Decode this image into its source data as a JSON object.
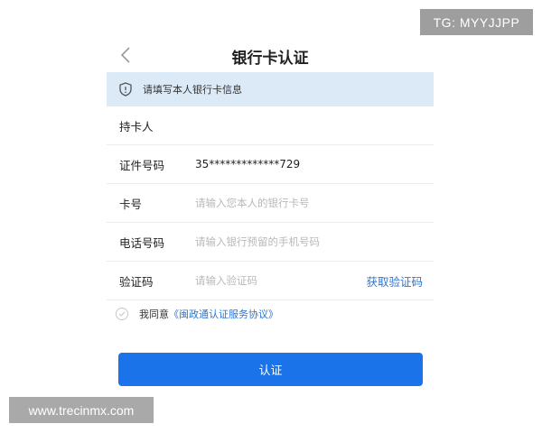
{
  "watermarks": {
    "top": "TG: MYYJJPP",
    "bottom": "www.trecinmx.com"
  },
  "header": {
    "title": "银行卡认证",
    "back_icon": "chevron-left-icon"
  },
  "notice": {
    "icon": "shield-icon",
    "text": "请填写本人银行卡信息"
  },
  "form": {
    "cardholder": {
      "label": "持卡人",
      "value": ""
    },
    "id_number": {
      "label": "证件号码",
      "value": "35*************729"
    },
    "card_number": {
      "label": "卡号",
      "placeholder": "请输入您本人的银行卡号"
    },
    "phone": {
      "label": "电话号码",
      "placeholder": "请输入银行预留的手机号码"
    },
    "code": {
      "label": "验证码",
      "placeholder": "请输入验证码",
      "action": "获取验证码"
    }
  },
  "agreement": {
    "prefix": "我同意",
    "link": "《闽政通认证服务协议》"
  },
  "submit": {
    "label": "认证"
  },
  "colors": {
    "accent": "#1a73e8",
    "link": "#2f75d1",
    "notice_bg": "#dceaf8"
  }
}
